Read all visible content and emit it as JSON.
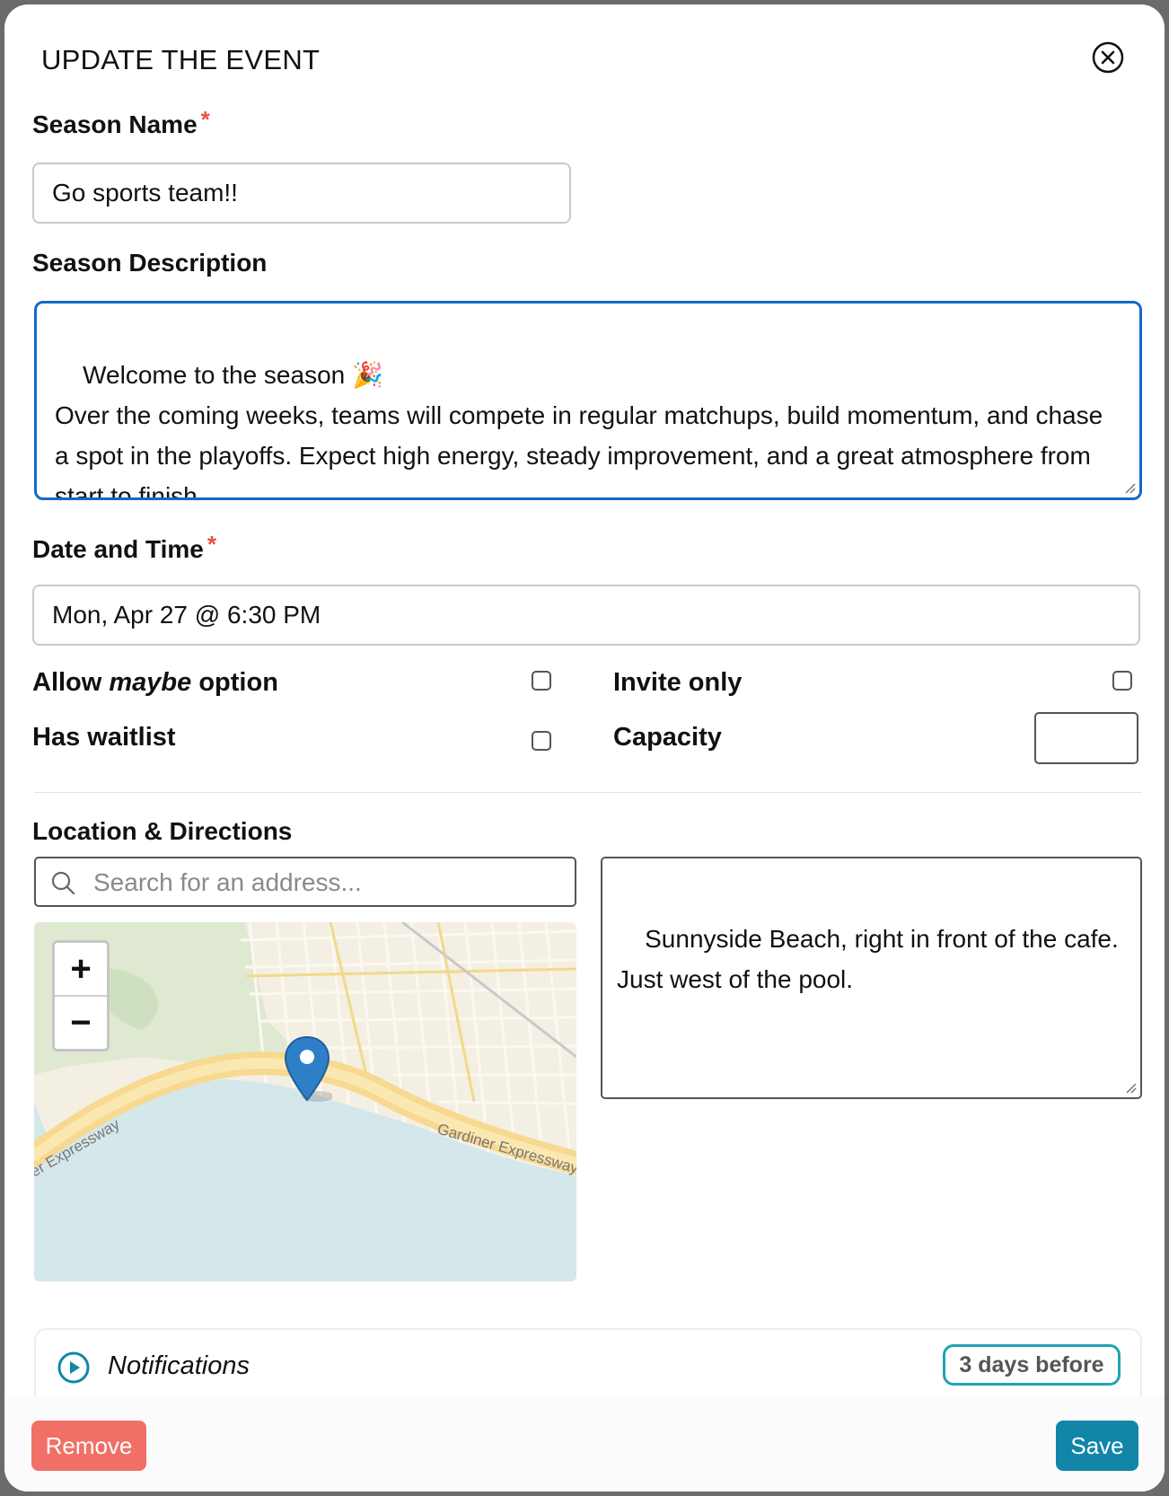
{
  "modal": {
    "title": "UPDATE THE EVENT"
  },
  "season_name": {
    "label": "Season Name",
    "required_mark": "*",
    "value": "Go sports team!!"
  },
  "season_description": {
    "label": "Season Description",
    "value": "Welcome to the season 🎉\nOver the coming weeks, teams will compete in regular matchups, build momentum, and chase a spot in the playoffs. Expect high energy, steady improvement, and a great atmosphere from start to finish."
  },
  "date_time": {
    "label": "Date and Time",
    "required_mark": "*",
    "value": "Mon, Apr 27 @ 6:30 PM"
  },
  "options": {
    "allow_maybe_prefix": "Allow ",
    "allow_maybe_emphasis": "maybe",
    "allow_maybe_suffix": " option",
    "invite_only": "Invite only",
    "has_waitlist": "Has waitlist",
    "capacity": "Capacity"
  },
  "location": {
    "label": "Location & Directions",
    "search_placeholder": "Search for an address...",
    "directions": "Sunnyside Beach, right in front of the cafe.\nJust west of the pool.",
    "map_road_left": "er Expressway",
    "map_road_right": "Gardiner Expressway",
    "zoom_in": "+",
    "zoom_out": "−"
  },
  "notifications": {
    "label": "Notifications",
    "badge": "3 days before"
  },
  "footer": {
    "remove": "Remove",
    "save": "Save"
  },
  "colors": {
    "accent_blue": "#1768c9",
    "required_red": "#e5533d",
    "remove_red": "#f07067",
    "save_teal": "#1285a9",
    "badge_teal": "#1fa3b2",
    "pin_blue": "#2f7fc8"
  },
  "icons": {
    "close": "close-circle-icon",
    "search": "search-icon",
    "map_pin": "map-pin-icon",
    "notifications_toggle": "play-circle-icon"
  }
}
